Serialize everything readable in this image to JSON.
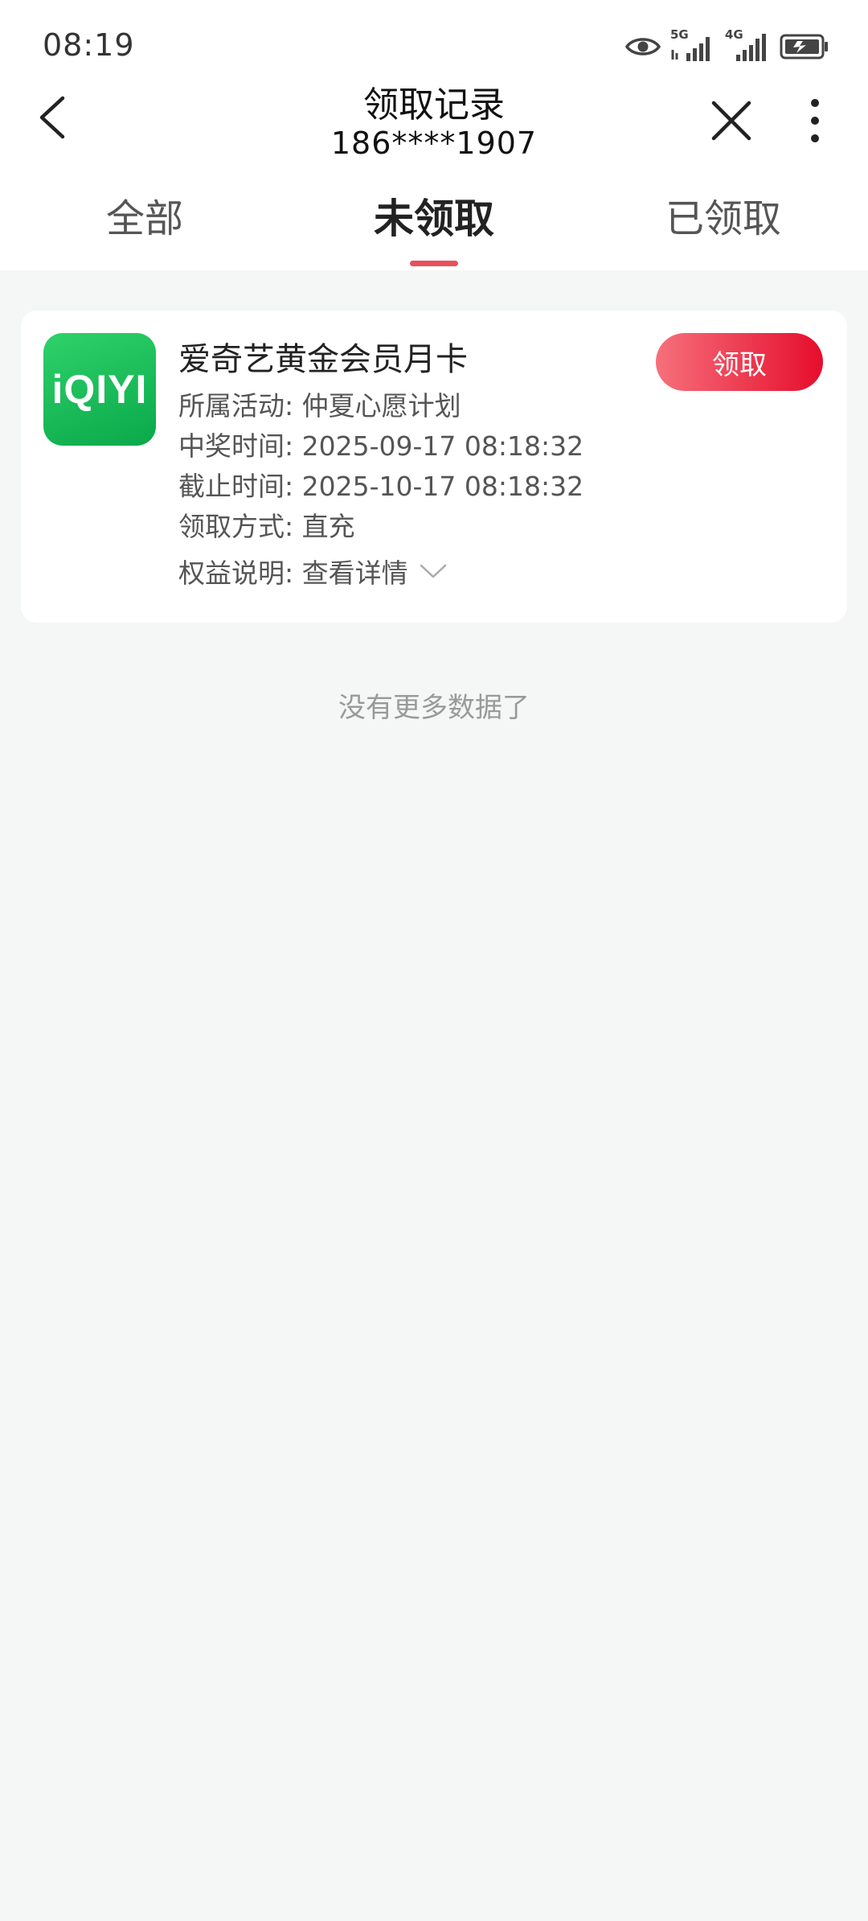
{
  "status_bar": {
    "time": "08:19",
    "network_1": "5G",
    "network_2": "4G",
    "icons": [
      "eye-icon",
      "signal-5g-icon",
      "signal-4g-icon",
      "battery-charging-icon"
    ]
  },
  "header": {
    "title": "领取记录",
    "subtitle": "186****1907"
  },
  "tabs": [
    {
      "label": "全部",
      "active": false
    },
    {
      "label": "未领取",
      "active": true
    },
    {
      "label": "已领取",
      "active": false
    }
  ],
  "card": {
    "logo_text": "iQIYI",
    "title": "爱奇艺黄金会员月卡",
    "claim_label": "领取",
    "rows": [
      {
        "label": "所属活动:",
        "value": "仲夏心愿计划"
      },
      {
        "label": "中奖时间:",
        "value": "2025-09-17 08:18:32"
      },
      {
        "label": "截止时间:",
        "value": "2025-10-17 08:18:32"
      },
      {
        "label": "领取方式:",
        "value": "直充"
      }
    ],
    "benefit_label": "权益说明:",
    "benefit_link": "查看详情"
  },
  "footer_text": "没有更多数据了",
  "colors": {
    "accent": "#e8505b",
    "button_start": "#f6707b",
    "button_end": "#e60d2c",
    "logo_green": "#0aa84a",
    "background": "#f5f6f6"
  }
}
